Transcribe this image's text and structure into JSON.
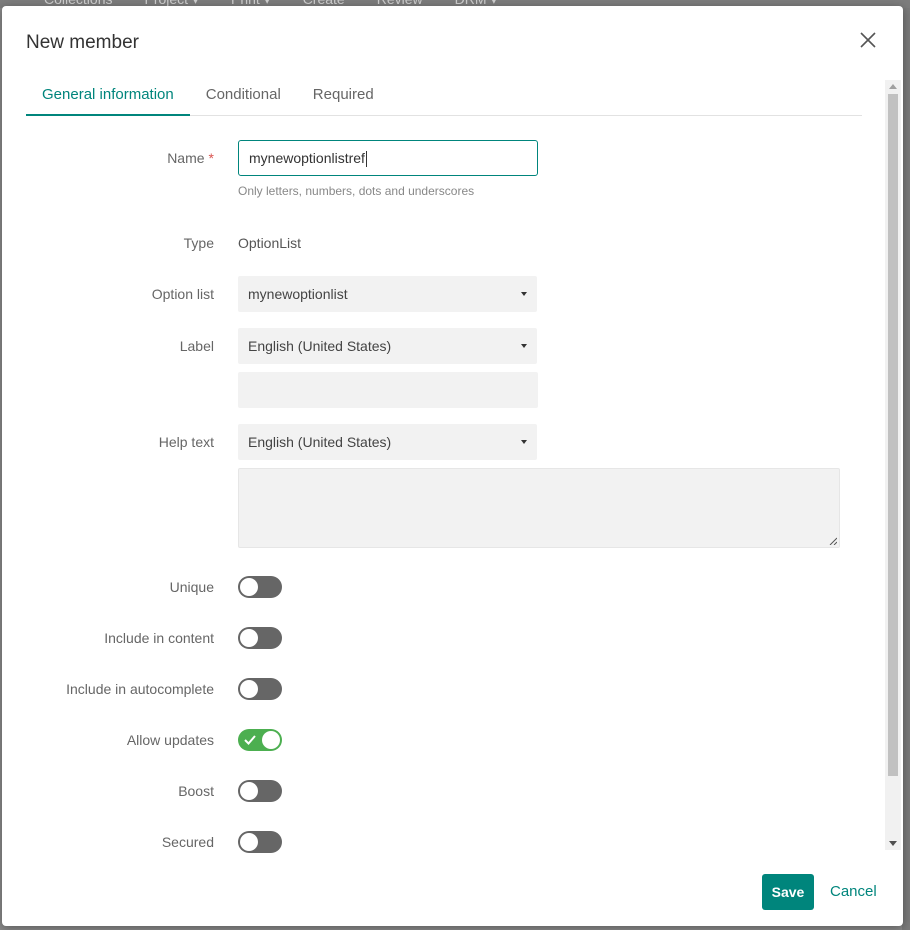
{
  "background_nav": [
    "Collections",
    "Project ▾",
    "Print ▾",
    "Create",
    "Review",
    "DRM ▾"
  ],
  "dialog": {
    "title": "New member",
    "tabs": [
      {
        "label": "General information",
        "active": true
      },
      {
        "label": "Conditional",
        "active": false
      },
      {
        "label": "Required",
        "active": false
      }
    ]
  },
  "form": {
    "name": {
      "label": "Name",
      "required_mark": "*",
      "value": "mynewoptionlistref",
      "hint": "Only letters, numbers, dots and underscores"
    },
    "type": {
      "label": "Type",
      "value": "OptionList"
    },
    "option_list": {
      "label": "Option list",
      "value": "mynewoptionlist"
    },
    "label": {
      "label": "Label",
      "language": "English (United States)",
      "value": ""
    },
    "help_text": {
      "label": "Help text",
      "language": "English (United States)",
      "value": ""
    },
    "toggles": [
      {
        "label": "Unique",
        "on": false
      },
      {
        "label": "Include in content",
        "on": false
      },
      {
        "label": "Include in autocomplete",
        "on": false
      },
      {
        "label": "Allow updates",
        "on": true
      },
      {
        "label": "Boost",
        "on": false
      },
      {
        "label": "Secured",
        "on": false
      }
    ]
  },
  "footer": {
    "save_label": "Save",
    "cancel_label": "Cancel"
  },
  "colors": {
    "accent": "#00857c",
    "toggle_on": "#4caf50",
    "toggle_off": "#666666",
    "required": "#d9534f"
  }
}
